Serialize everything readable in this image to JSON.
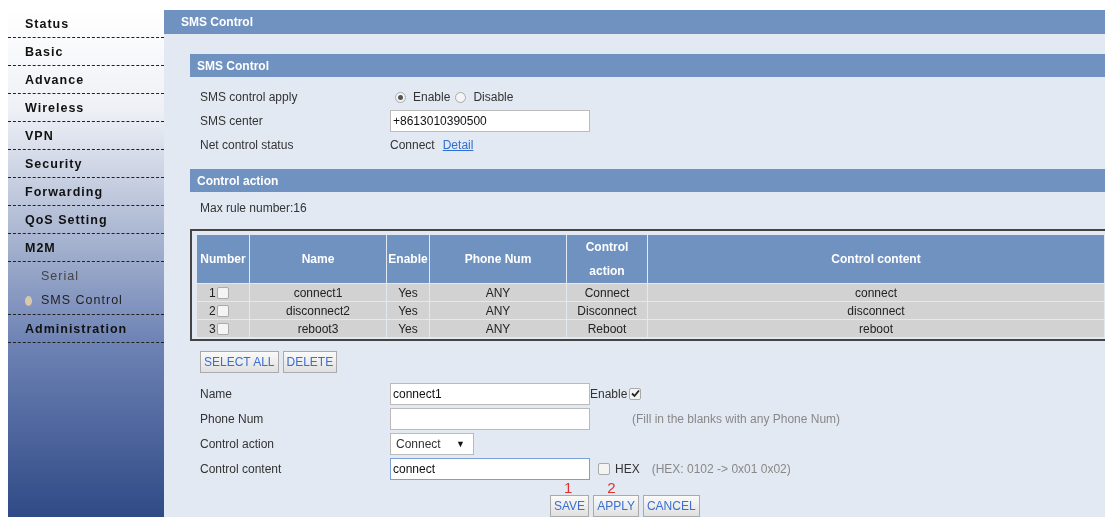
{
  "sidebar": {
    "items": [
      {
        "label": "Status",
        "selected": false
      },
      {
        "label": "Basic",
        "selected": false
      },
      {
        "label": "Advance",
        "selected": false
      },
      {
        "label": "Wireless",
        "selected": false
      },
      {
        "label": "VPN",
        "selected": false
      },
      {
        "label": "Security",
        "selected": false
      },
      {
        "label": "Forwarding",
        "selected": false
      },
      {
        "label": "QoS Setting",
        "selected": false
      },
      {
        "label": "M2M",
        "selected": false,
        "children": [
          {
            "label": "Serial",
            "selected": false
          },
          {
            "label": "SMS Control",
            "selected": true
          }
        ]
      },
      {
        "label": "Administration",
        "selected": false
      }
    ]
  },
  "page_title": "SMS Control",
  "sms_section": {
    "title": "SMS Control",
    "apply": {
      "label": "SMS control apply",
      "options": [
        {
          "label": "Enable",
          "selected": true
        },
        {
          "label": "Disable",
          "selected": false
        }
      ]
    },
    "center": {
      "label": "SMS center",
      "value": "+8613010390500"
    },
    "status": {
      "label": "Net control status",
      "value": "Connect",
      "link": "Detail"
    }
  },
  "action_section": {
    "title": "Control action",
    "max_rule": "Max rule number:16",
    "table": {
      "columns": [
        "Number",
        "Name",
        "Enable",
        "Phone Num",
        "Control action",
        "Control content"
      ],
      "rows": [
        {
          "number": "1",
          "checked": false,
          "name": "connect1",
          "enable": "Yes",
          "phone": "ANY",
          "action": "Connect",
          "content": "connect"
        },
        {
          "number": "2",
          "checked": false,
          "name": "disconnect2",
          "enable": "Yes",
          "phone": "ANY",
          "action": "Disconnect",
          "content": "disconnect"
        },
        {
          "number": "3",
          "checked": false,
          "name": "reboot3",
          "enable": "Yes",
          "phone": "ANY",
          "action": "Reboot",
          "content": "reboot"
        }
      ]
    },
    "table_buttons": [
      "SELECT ALL",
      "DELETE"
    ],
    "form": {
      "name": {
        "label": "Name",
        "value": "connect1",
        "enable_label": "Enable",
        "enable_checked": true
      },
      "phone": {
        "label": "Phone Num",
        "hint": "(Fill in the blanks with any Phone Num)"
      },
      "action": {
        "label": "Control action",
        "value": "Connect",
        "caret": "▼"
      },
      "content": {
        "label": "Control content",
        "value": "connect",
        "hex_label": "HEX",
        "hex_checked": false,
        "hint": "(HEX: 0102 -> 0x01 0x02)"
      }
    },
    "buttons": [
      {
        "label": "SAVE",
        "annotation": "1"
      },
      {
        "label": "APPLY",
        "annotation": "2"
      },
      {
        "label": "CANCEL"
      }
    ]
  }
}
